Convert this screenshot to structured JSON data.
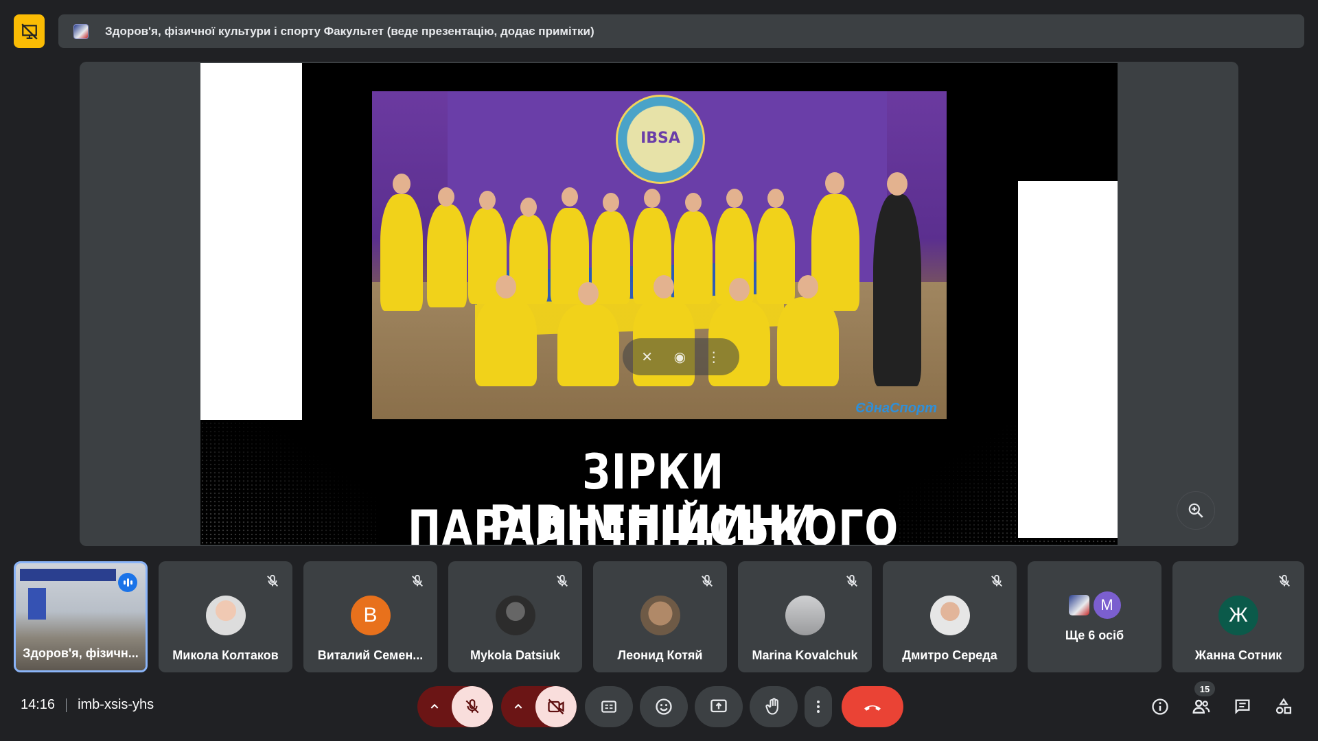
{
  "header": {
    "presenting_text": "Здоров'я, фізичної культури і спорту Факультет (веде презентацію, додає примітки)"
  },
  "slide": {
    "title_line1": "ЗІРКИ ПАРАЛІМПІЙСЬКОГО СПОРТУ",
    "title_line2": "РІВНЕНЩИНИ",
    "photo_banner_text": "IBSA",
    "photo_watermark": "ЄднаСпорт"
  },
  "participants": [
    {
      "name": "Здоров'я, фізичн...",
      "avatar": "video",
      "speaking": true
    },
    {
      "name": "Микола Колтаков",
      "avatar": "photo",
      "muted": true
    },
    {
      "name": "Виталий Семен...",
      "avatar": "letter",
      "letter": "В",
      "muted": true
    },
    {
      "name": "Mykola Datsiuk",
      "avatar": "photo",
      "muted": true
    },
    {
      "name": "Леонид Котяй",
      "avatar": "photo",
      "muted": true
    },
    {
      "name": "Marina Kovalchuk",
      "avatar": "photo",
      "muted": true
    },
    {
      "name": "Дмитро Середа",
      "avatar": "photo",
      "muted": true
    },
    {
      "name": "Ще 6 осіб",
      "avatar": "group",
      "letter": "M"
    },
    {
      "name": "Жанна Сотник",
      "avatar": "letter",
      "letter": "Ж",
      "muted": true
    }
  ],
  "footer": {
    "time": "14:16",
    "meeting_code": "imb-xsis-yhs",
    "people_count": "15"
  },
  "icons": {
    "presenting": "presentation-off-icon",
    "mic": "mic-off-icon",
    "camera": "videocam-off-icon",
    "captions": "closed-caption-icon",
    "emoji": "emoji-icon",
    "present": "present-screen-icon",
    "hand": "raise-hand-icon",
    "more": "more-vert-icon",
    "hangup": "call-end-icon",
    "info": "info-icon",
    "people": "people-icon",
    "chat": "chat-icon",
    "activities": "activities-icon"
  },
  "colors": {
    "accent": "#8ab4f8",
    "hangup": "#ea4335",
    "muted_bg": "#f9dedc",
    "presenting": "#fbbc04"
  }
}
